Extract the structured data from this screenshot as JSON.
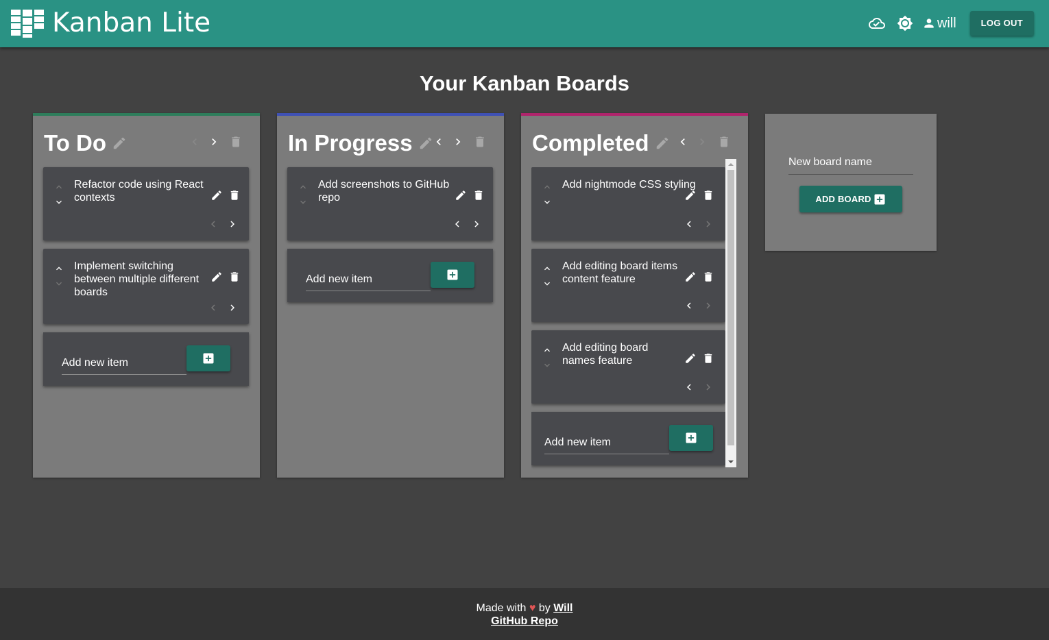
{
  "app": {
    "title": "Kanban Lite"
  },
  "header": {
    "username": "will",
    "logout_label": "LOG OUT"
  },
  "page": {
    "title": "Your Kanban Boards"
  },
  "boards": [
    {
      "name": "To Do",
      "accent": "#2e7d5b",
      "items": [
        {
          "text": "Refactor code using React contexts"
        },
        {
          "text": "Implement switching between multiple different boards"
        }
      ],
      "add_placeholder": "Add new item"
    },
    {
      "name": "In Progress",
      "accent": "#3f51b5",
      "items": [
        {
          "text": "Add screenshots to GitHub repo"
        }
      ],
      "add_placeholder": "Add new item"
    },
    {
      "name": "Completed",
      "accent": "#b0246c",
      "items": [
        {
          "text": "Add nightmode CSS styling"
        },
        {
          "text": "Add editing board items content feature"
        },
        {
          "text": "Add editing board names feature"
        }
      ],
      "add_placeholder": "Add new item"
    }
  ],
  "new_board": {
    "placeholder": "New board name",
    "button_label": "ADD BOARD"
  },
  "footer": {
    "made_with": "Made with",
    "heart": "♥",
    "by": "by",
    "author": "Will",
    "repo_link": "GitHub Repo"
  },
  "colors": {
    "appbar": "#2a9284",
    "button": "#1f6e62",
    "background": "#424242",
    "board": "#7b7b7b",
    "card": "#48494d"
  }
}
